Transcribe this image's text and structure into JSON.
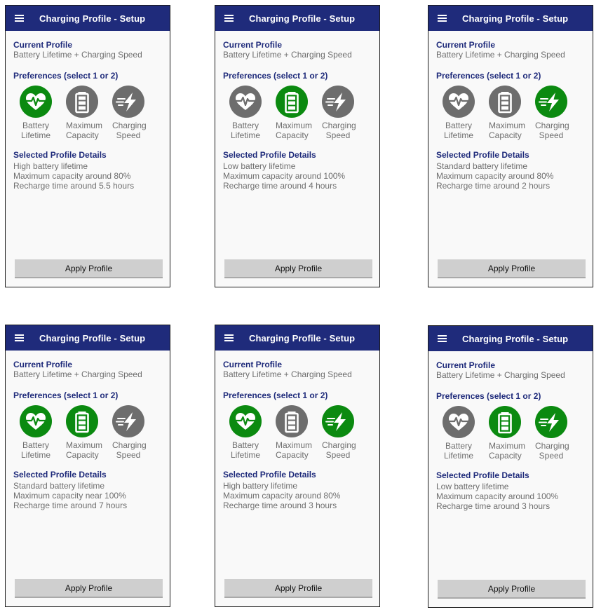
{
  "colors": {
    "appbar": "#1f2b7b",
    "selected": "#0b8a10",
    "unselected": "#6d6d6d"
  },
  "screens": [
    {
      "title": "Charging Profile - Setup",
      "current_label": "Current Profile",
      "current_value": "Battery Lifetime + Charging Speed",
      "prefs_label": "Preferences (select 1 or 2)",
      "prefs": [
        {
          "line1": "Battery",
          "line2": "Lifetime",
          "icon": "heart-pulse-icon",
          "selected": true
        },
        {
          "line1": "Maximum",
          "line2": "Capacity",
          "icon": "battery-icon",
          "selected": false
        },
        {
          "line1": "Charging",
          "line2": "Speed",
          "icon": "fast-charge-icon",
          "selected": false
        }
      ],
      "details_label": "Selected Profile Details",
      "details": [
        "High battery lifetime",
        "Maximum capacity around 80%",
        "Recharge time around 5.5 hours"
      ],
      "apply_label": "Apply Profile"
    },
    {
      "title": "Charging Profile - Setup",
      "current_label": "Current Profile",
      "current_value": "Battery Lifetime + Charging Speed",
      "prefs_label": "Preferences (select 1 or 2)",
      "prefs": [
        {
          "line1": "Battery",
          "line2": "Lifetime",
          "icon": "heart-pulse-icon",
          "selected": false
        },
        {
          "line1": "Maximum",
          "line2": "Capacity",
          "icon": "battery-icon",
          "selected": true
        },
        {
          "line1": "Charging",
          "line2": "Speed",
          "icon": "fast-charge-icon",
          "selected": false
        }
      ],
      "details_label": "Selected Profile Details",
      "details": [
        "Low battery lifetime",
        "Maximum capacity around 100%",
        "Recharge time around 4 hours"
      ],
      "apply_label": "Apply Profile"
    },
    {
      "title": "Charging Profile - Setup",
      "current_label": "Current Profile",
      "current_value": "Battery Lifetime + Charging Speed",
      "prefs_label": "Preferences (select 1 or 2)",
      "prefs": [
        {
          "line1": "Battery",
          "line2": "Lifetime",
          "icon": "heart-pulse-icon",
          "selected": false
        },
        {
          "line1": "Maximum",
          "line2": "Capacity",
          "icon": "battery-icon",
          "selected": false
        },
        {
          "line1": "Charging",
          "line2": "Speed",
          "icon": "fast-charge-icon",
          "selected": true
        }
      ],
      "details_label": "Selected Profile Details",
      "details": [
        "Standard battery lifetime",
        "Maximum capacity around 80%",
        "Recharge time around 2 hours"
      ],
      "apply_label": "Apply Profile"
    },
    {
      "title": "Charging Profile - Setup",
      "current_label": "Current Profile",
      "current_value": "Battery Lifetime + Charging Speed",
      "prefs_label": "Preferences (select 1 or 2)",
      "prefs": [
        {
          "line1": "Battery",
          "line2": "Lifetime",
          "icon": "heart-pulse-icon",
          "selected": true
        },
        {
          "line1": "Maximum",
          "line2": "Capacity",
          "icon": "battery-icon",
          "selected": true
        },
        {
          "line1": "Charging",
          "line2": "Speed",
          "icon": "fast-charge-icon",
          "selected": false
        }
      ],
      "details_label": "Selected Profile Details",
      "details": [
        "Standard battery lifetime",
        "Maximum capacity near 100%",
        "Recharge time around 7 hours"
      ],
      "apply_label": "Apply Profile"
    },
    {
      "title": "Charging Profile - Setup",
      "current_label": "Current Profile",
      "current_value": "Battery Lifetime + Charging Speed",
      "prefs_label": "Preferences (select 1 or 2)",
      "prefs": [
        {
          "line1": "Battery",
          "line2": "Lifetime",
          "icon": "heart-pulse-icon",
          "selected": true
        },
        {
          "line1": "Maximum",
          "line2": "Capacity",
          "icon": "battery-icon",
          "selected": false
        },
        {
          "line1": "Charging",
          "line2": "Speed",
          "icon": "fast-charge-icon",
          "selected": true
        }
      ],
      "details_label": "Selected Profile Details",
      "details": [
        "High battery lifetime",
        "Maximum capacity around 80%",
        "Recharge time around 3 hours"
      ],
      "apply_label": "Apply Profile"
    },
    {
      "title": "Charging Profile - Setup",
      "current_label": "Current Profile",
      "current_value": "Battery Lifetime + Charging Speed",
      "prefs_label": "Preferences (select 1 or 2)",
      "prefs": [
        {
          "line1": "Battery",
          "line2": "Lifetime",
          "icon": "heart-pulse-icon",
          "selected": false
        },
        {
          "line1": "Maximum",
          "line2": "Capacity",
          "icon": "battery-icon",
          "selected": true
        },
        {
          "line1": "Charging",
          "line2": "Speed",
          "icon": "fast-charge-icon",
          "selected": true
        }
      ],
      "details_label": "Selected Profile Details",
      "details": [
        "Low battery lifetime",
        "Maximum capacity around 100%",
        "Recharge time around 3 hours"
      ],
      "apply_label": "Apply Profile"
    }
  ]
}
